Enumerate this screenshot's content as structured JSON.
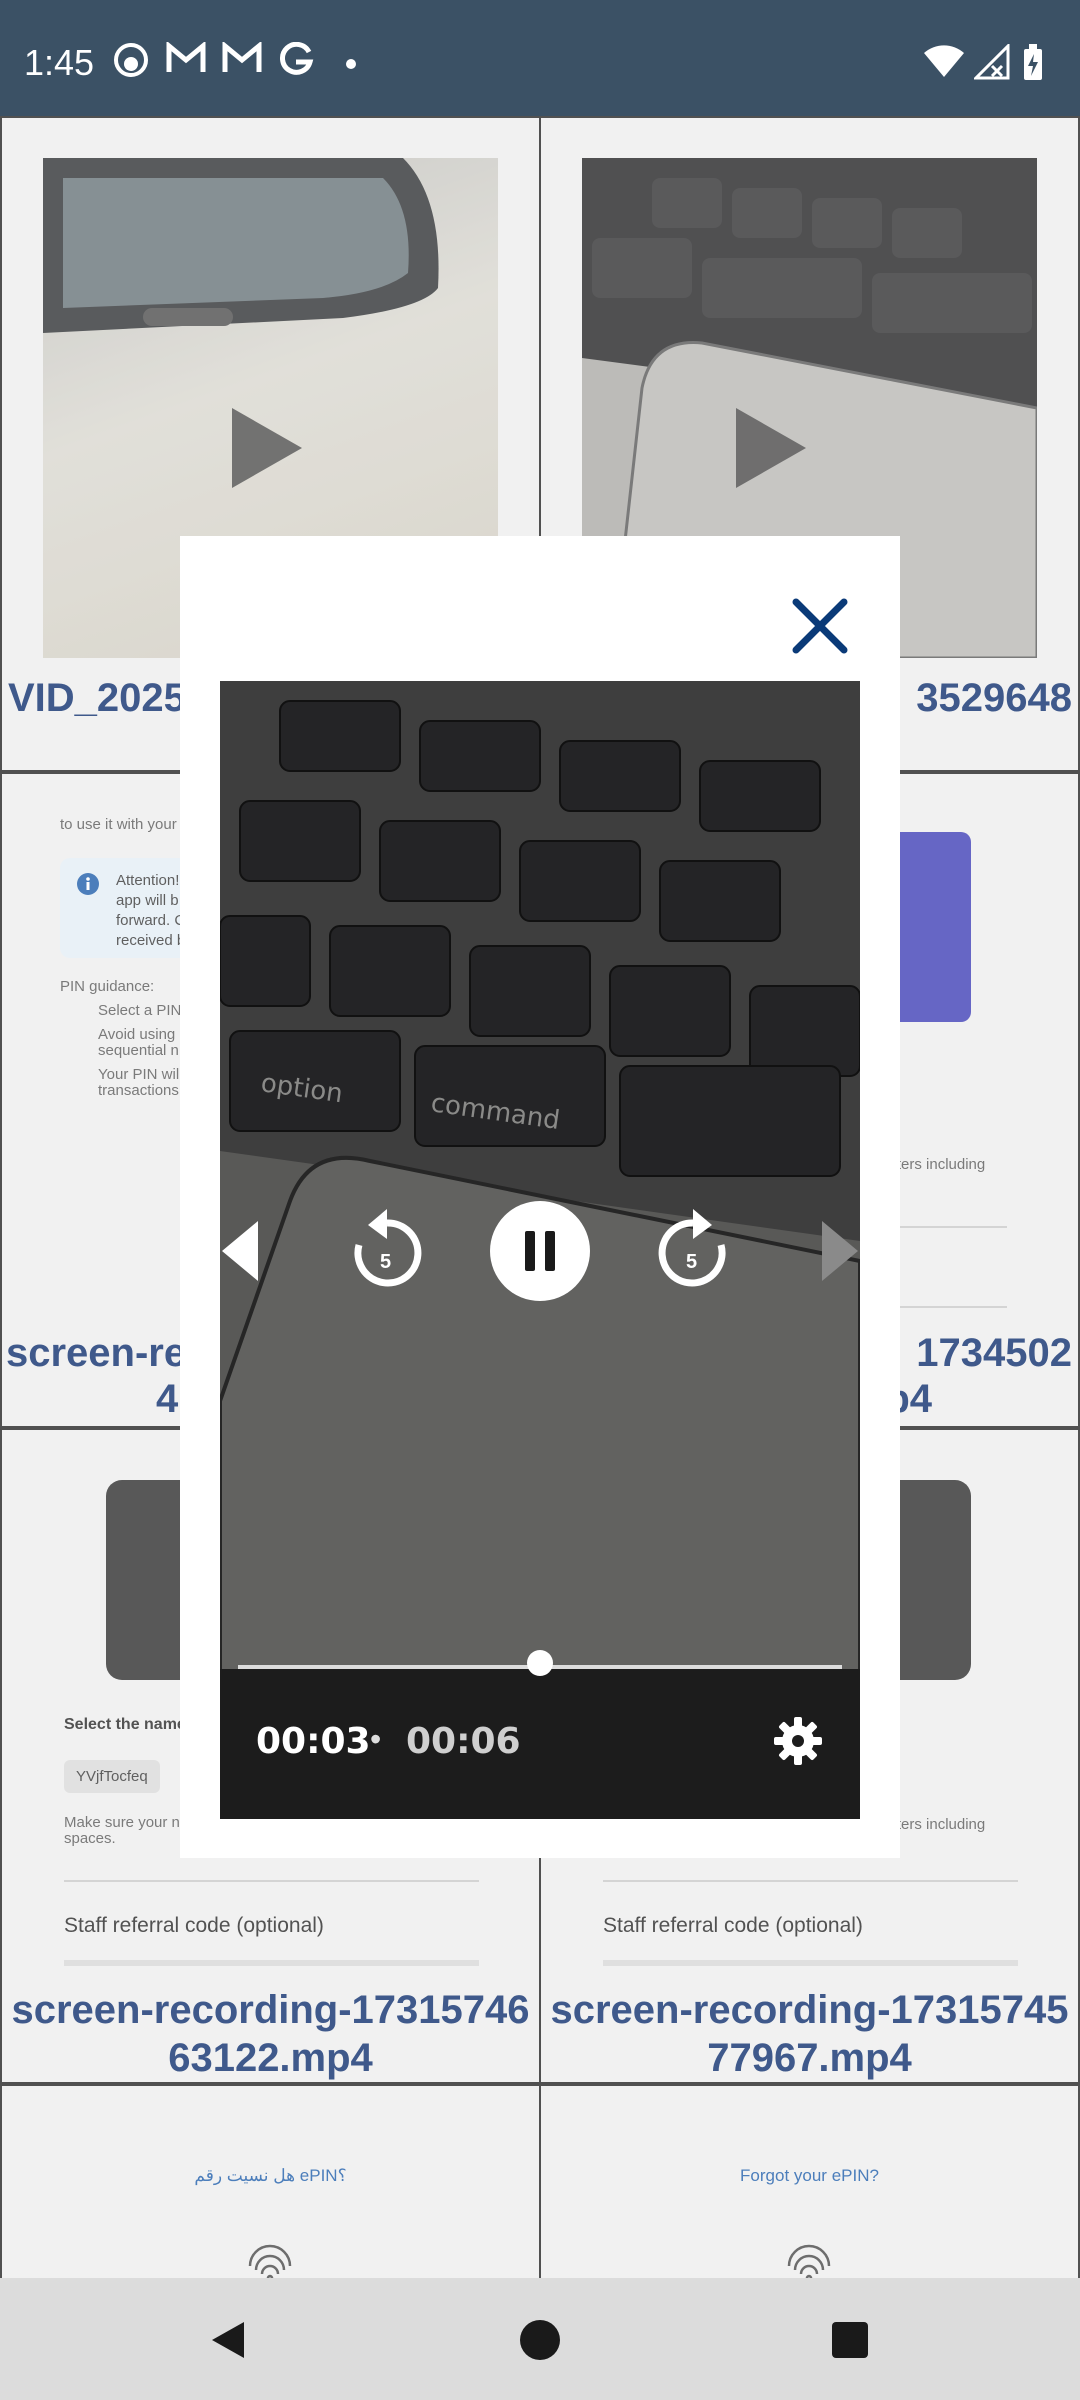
{
  "status_bar": {
    "time": "1:45",
    "notification_icons": [
      "face-icon",
      "gmail-icon",
      "gmail-icon",
      "google-icon",
      "dot-icon"
    ],
    "system_icons": [
      "wifi-icon",
      "signal-icon",
      "battery-icon"
    ]
  },
  "grid": {
    "captions": {
      "c1_line1": "VID_2025",
      "c2_line1": "3529648",
      "c3_line1": "screen-re",
      "c3_line2": "4",
      "c4_line1": "1734502",
      "c4_line2": "p4",
      "c5_line1": "screen-recording-17315746",
      "c5_line2": "63122.mp4",
      "c6_line1": "screen-recording-17315745",
      "c6_line2": "77967.mp4"
    },
    "doc": {
      "use_text": "to use it with your",
      "attention_1": "Attention!",
      "attention_2": "app will b",
      "attention_3": "forward. C",
      "attention_4": "received b",
      "pin_guidance": "PIN guidance:",
      "bullet_1": "Select a PIN",
      "bullet_2a": "Avoid using",
      "bullet_2b": "sequential n",
      "bullet_3a": "Your PIN will",
      "bullet_3b": "transactions",
      "characters_including": "acters including",
      "select_name": "Select the name",
      "username_chip": "YVjfTocfeq",
      "make_sure_1": "Make sure your na",
      "make_sure_2": "spaces.",
      "characters_including_2": "acters including",
      "staff_referral": "Staff referral code (optional)",
      "forgot_arabic": "هل نسيت رقم ePIN؟",
      "forgot_english": "Forgot your ePIN?"
    }
  },
  "player": {
    "current_time": "00:03",
    "separator": "•",
    "total_time": "00:06",
    "rewind_seconds": "5",
    "forward_seconds": "5",
    "progress": 0.5
  },
  "colors": {
    "status_bar_bg": "#04203a",
    "caption_color": "#0a2b6b",
    "close_icon": "#0a3a78"
  }
}
